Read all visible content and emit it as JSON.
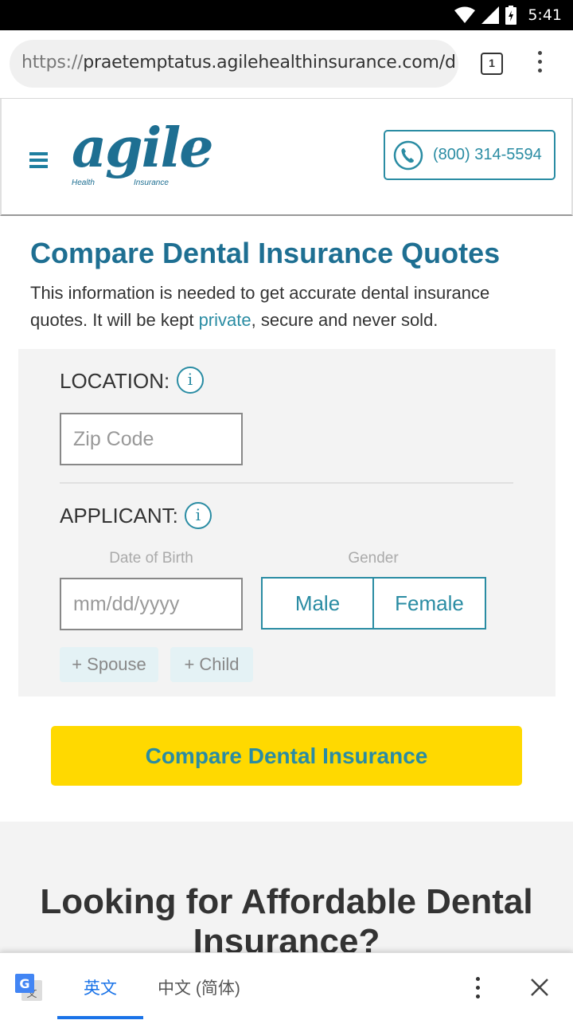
{
  "status_bar": {
    "time": "5:41"
  },
  "browser": {
    "url_protocol": "https://",
    "url_host": "praetemptatus.agilehealthinsurance.com/d",
    "tab_count": "1"
  },
  "header": {
    "logo_text": "agile",
    "logo_reg": "®",
    "logo_tag_left": "Health",
    "logo_tag_right": "Insurance",
    "phone": "(800) 314-5594"
  },
  "main": {
    "title": "Compare Dental Insurance Quotes",
    "intro_before": "This information is needed to get accurate dental insurance quotes. It will be kept ",
    "intro_link": "private",
    "intro_after": ", secure and never sold."
  },
  "form": {
    "location_label": "LOCATION:",
    "info_glyph": "i",
    "zip_placeholder": "Zip Code",
    "applicant_label": "APPLICANT:",
    "dob_label": "Date of Birth",
    "dob_placeholder": "mm/dd/yyyy",
    "gender_label": "Gender",
    "gender_male": "Male",
    "gender_female": "Female",
    "add_spouse": "+ Spouse",
    "add_child": "+ Child",
    "submit": "Compare Dental Insurance"
  },
  "lower": {
    "title": "Looking for Affordable Dental Insurance?"
  },
  "translate": {
    "source_lang": "英文",
    "target_lang": "中文 (简体)"
  },
  "colors": {
    "brand_blue": "#1e6f92",
    "teal": "#2a8ca3",
    "cta_yellow": "#ffd900"
  }
}
